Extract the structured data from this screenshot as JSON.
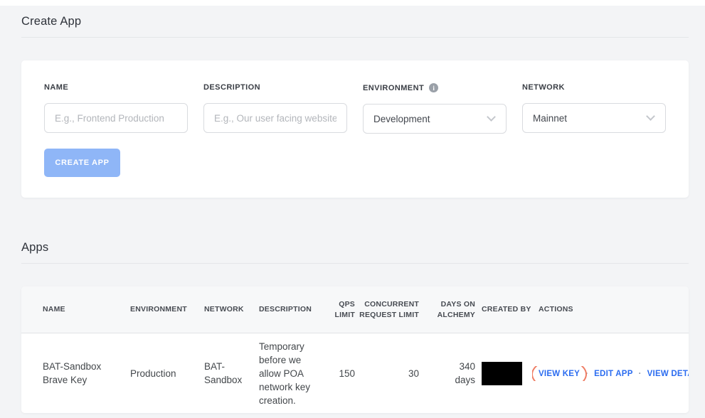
{
  "create_app": {
    "title": "Create App",
    "fields": [
      {
        "label": "NAME",
        "placeholder": "E.g., Frontend Production"
      },
      {
        "label": "DESCRIPTION",
        "placeholder": "E.g., Our user facing website"
      },
      {
        "label": "ENVIRONMENT",
        "value": "Development",
        "has_info_icon": true
      },
      {
        "label": "NETWORK",
        "value": "Mainnet"
      }
    ],
    "submit_label": "CREATE APP"
  },
  "apps": {
    "title": "Apps",
    "table": {
      "headers": [
        "NAME",
        "ENVIRONMENT",
        "NETWORK",
        "DESCRIPTION",
        "QPS LIMIT",
        "CONCURRENT REQUEST LIMIT",
        "DAYS ON ALCHEMY",
        "CREATED BY",
        "ACTIONS"
      ],
      "rows": [
        {
          "name": "BAT-Sandbox Brave Key",
          "environment": "Production",
          "network": "BAT-Sandbox",
          "description": "Temporary before we allow POA network key creation.",
          "qps_limit": "150",
          "concurrent_request_limit": "30",
          "days_on_alchemy": "340 days",
          "created_by_redacted": true,
          "actions": [
            {
              "label": "VIEW KEY",
              "annotated": true
            },
            {
              "label": "EDIT APP"
            },
            {
              "label": "VIEW DETAILS"
            }
          ],
          "action_separator": "·"
        }
      ]
    }
  },
  "colors": {
    "page_background": "#f3f4f6",
    "button_blue": "#8fb6f7",
    "link_blue": "#2b6cf0",
    "annotation_coral": "#ef7c63",
    "redaction": "#000000"
  }
}
